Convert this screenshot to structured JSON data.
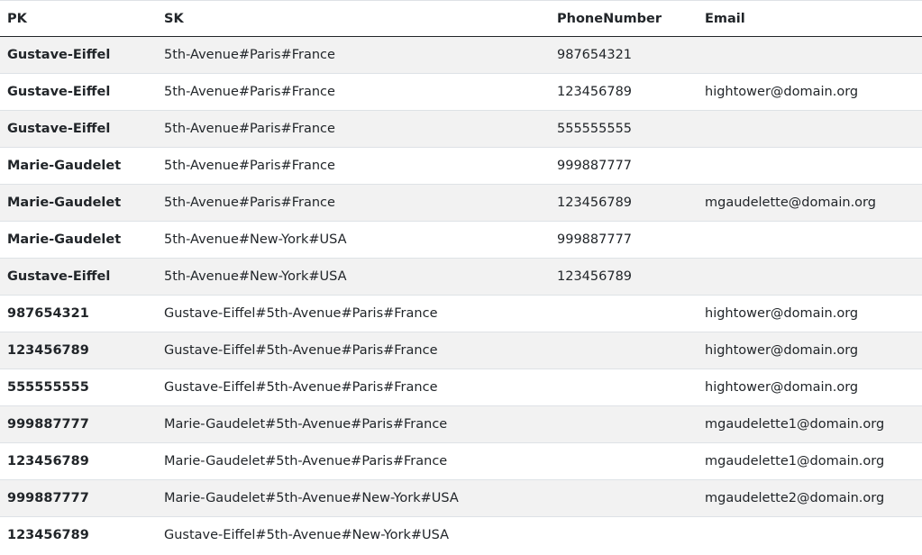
{
  "table": {
    "headers": [
      "PK",
      "SK",
      "PhoneNumber",
      "Email"
    ],
    "rows": [
      [
        "Gustave-Eiffel",
        "5th-Avenue#Paris#France",
        "987654321",
        ""
      ],
      [
        "Gustave-Eiffel",
        "5th-Avenue#Paris#France",
        "123456789",
        "hightower@domain.org"
      ],
      [
        "Gustave-Eiffel",
        "5th-Avenue#Paris#France",
        "555555555",
        ""
      ],
      [
        "Marie-Gaudelet",
        "5th-Avenue#Paris#France",
        "999887777",
        ""
      ],
      [
        "Marie-Gaudelet",
        "5th-Avenue#Paris#France",
        "123456789",
        "mgaudelette@domain.org"
      ],
      [
        "Marie-Gaudelet",
        "5th-Avenue#New-York#USA",
        "999887777",
        ""
      ],
      [
        "Gustave-Eiffel",
        "5th-Avenue#New-York#USA",
        "123456789",
        ""
      ],
      [
        "987654321",
        "Gustave-Eiffel#5th-Avenue#Paris#France",
        "",
        "hightower@domain.org"
      ],
      [
        "123456789",
        "Gustave-Eiffel#5th-Avenue#Paris#France",
        "",
        "hightower@domain.org"
      ],
      [
        "555555555",
        "Gustave-Eiffel#5th-Avenue#Paris#France",
        "",
        "hightower@domain.org"
      ],
      [
        "999887777",
        "Marie-Gaudelet#5th-Avenue#Paris#France",
        "",
        "mgaudelette1@domain.org"
      ],
      [
        "123456789",
        "Marie-Gaudelet#5th-Avenue#Paris#France",
        "",
        "mgaudelette1@domain.org"
      ],
      [
        "999887777",
        "Marie-Gaudelet#5th-Avenue#New-York#USA",
        "",
        "mgaudelette2@domain.org"
      ],
      [
        "123456789",
        "Gustave-Eiffel#5th-Avenue#New-York#USA",
        "",
        ""
      ]
    ]
  }
}
